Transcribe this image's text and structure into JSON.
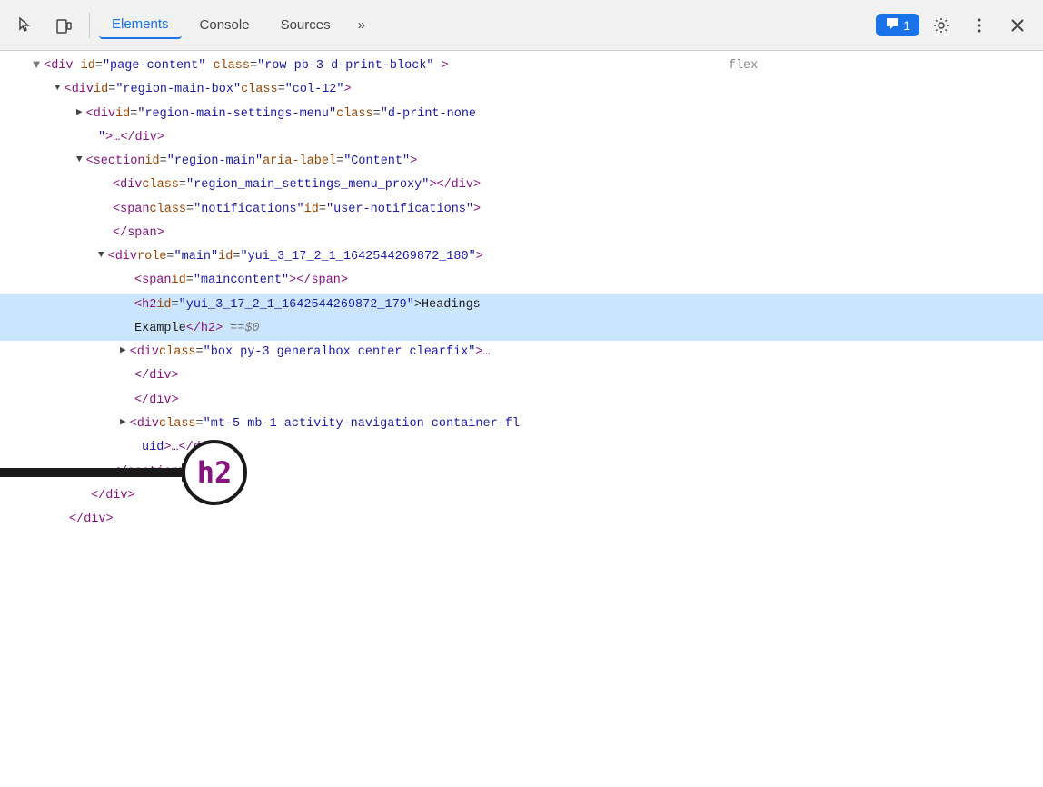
{
  "toolbar": {
    "cursor_icon": "⬡",
    "device_icon": "☐",
    "tabs": [
      {
        "id": "elements",
        "label": "Elements",
        "active": true
      },
      {
        "id": "console",
        "label": "Console",
        "active": false
      },
      {
        "id": "sources",
        "label": "Sources",
        "active": false
      }
    ],
    "more_tabs_label": "»",
    "badge_icon": "💬",
    "badge_count": "1",
    "settings_icon": "⚙",
    "menu_icon": "⋮",
    "close_icon": "✕"
  },
  "elements": {
    "lines": [
      {
        "id": "line-1",
        "indent": 1,
        "triangle": "none",
        "content": "<div id=\"page-content\" class=\"row pb-3 d-print-block",
        "suffix": "flex",
        "highlighted": false
      },
      {
        "id": "line-2",
        "indent": 2,
        "triangle": "down",
        "content": "<div id=\"region-main-box\" class=\"col-12\">",
        "highlighted": false
      },
      {
        "id": "line-3",
        "indent": 3,
        "triangle": "right",
        "content": "<div id=\"region-main-settings-menu\" class=\"d-print-none",
        "highlighted": false
      },
      {
        "id": "line-3b",
        "indent": 4,
        "triangle": "none",
        "content": "\">…</div>",
        "highlighted": false
      },
      {
        "id": "line-4",
        "indent": 3,
        "triangle": "down",
        "content": "<section id=\"region-main\" aria-label=\"Content\">",
        "highlighted": false
      },
      {
        "id": "line-5",
        "indent": 4,
        "triangle": "none",
        "content": "<div class=\"region_main_settings_menu_proxy\"></div>",
        "highlighted": false
      },
      {
        "id": "line-6",
        "indent": 4,
        "triangle": "none",
        "content": "<span class=\"notifications\" id=\"user-notifications\">",
        "highlighted": false
      },
      {
        "id": "line-7",
        "indent": 4,
        "triangle": "none",
        "content": "</span>",
        "highlighted": false
      },
      {
        "id": "line-8",
        "indent": 4,
        "triangle": "down",
        "content": "<div role=\"main\" id=\"yui_3_17_2_1_1642544269872_180\">",
        "highlighted": false
      },
      {
        "id": "line-9",
        "indent": 5,
        "triangle": "none",
        "content": "<span id=\"maincontent\"></span>",
        "highlighted": false
      },
      {
        "id": "line-10",
        "indent": 5,
        "triangle": "none",
        "content": "<h2 id=\"yui_3_17_2_1_1642544269872_179\">Headings",
        "suffix_text": "Example</h2>",
        "eq_sign": " == $0",
        "highlighted": true,
        "is_h2_line": true
      },
      {
        "id": "line-11",
        "indent": 5,
        "triangle": "right",
        "content": "<div class=\"box py-3 generalbox center clearfix\">…",
        "highlighted": false
      },
      {
        "id": "line-12",
        "indent": 5,
        "triangle": "none",
        "content": "</div>",
        "highlighted": false
      },
      {
        "id": "line-13",
        "indent": 5,
        "triangle": "none",
        "content": "</div>",
        "highlighted": false
      },
      {
        "id": "line-14",
        "indent": 5,
        "triangle": "right",
        "content": "<div class=\"mt-5 mb-1 activity-navigation container-fl",
        "highlighted": false
      },
      {
        "id": "line-14b",
        "indent": 6,
        "triangle": "none",
        "content": "uid\">…</div>",
        "highlighted": false
      },
      {
        "id": "line-15",
        "indent": 4,
        "triangle": "none",
        "content": "</section>",
        "highlighted": false
      },
      {
        "id": "line-16",
        "indent": 3,
        "triangle": "none",
        "content": "</div>",
        "highlighted": false
      },
      {
        "id": "line-17",
        "indent": 2,
        "triangle": "none",
        "content": "</div>",
        "highlighted": false
      }
    ]
  },
  "annotation": {
    "h2_label": "h2"
  }
}
